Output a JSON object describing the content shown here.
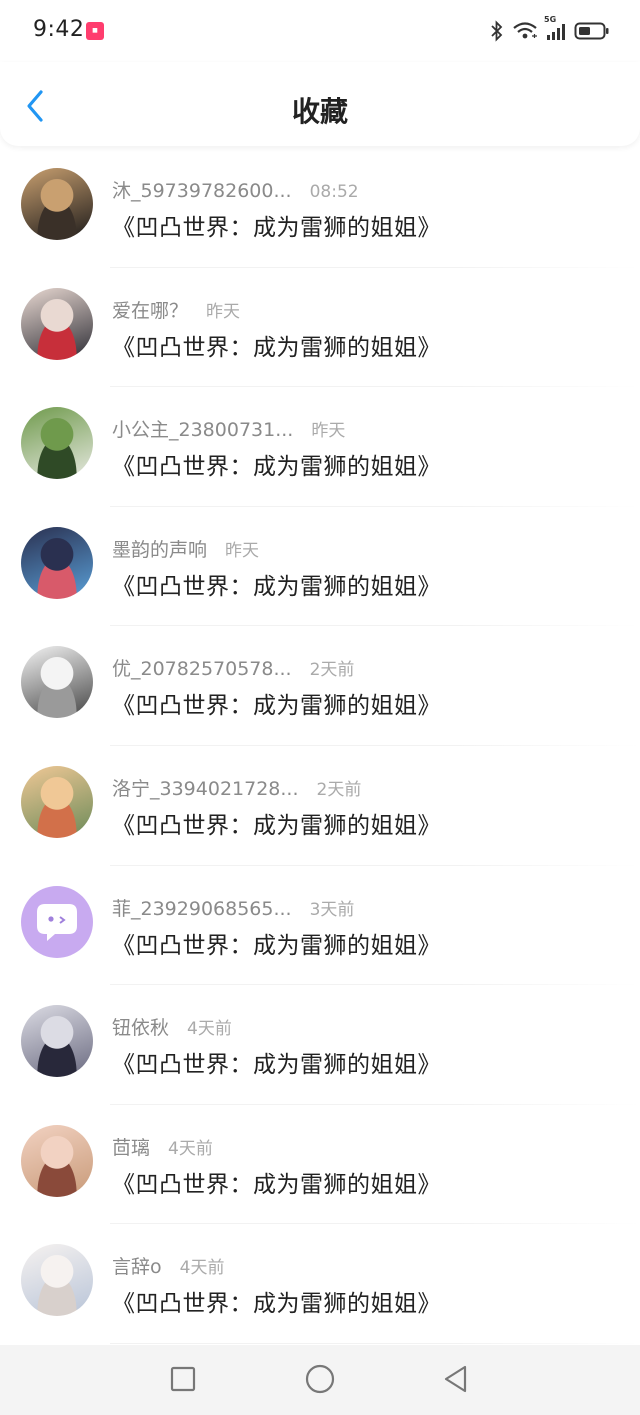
{
  "status_bar": {
    "time": "9:42",
    "app_icon": "app-notification-icon",
    "network_label": "5G",
    "icons": [
      "bluetooth-icon",
      "wifi-icon",
      "signal-icon",
      "battery-icon"
    ]
  },
  "header": {
    "title": "收藏",
    "back_icon": "chevron-left-icon",
    "accent_color": "#2196f3"
  },
  "items": [
    {
      "username": "沐_59739782600...",
      "time": "08:52",
      "title": "《凹凸世界：成为雷狮的姐姐》",
      "avatar_colors": [
        "#c9a070",
        "#3a3028",
        "#1c1a1a"
      ]
    },
    {
      "username": "爱在哪？",
      "time": "昨天",
      "title": "《凹凸世界：成为雷狮的姐姐》",
      "avatar_colors": [
        "#e9d9d2",
        "#c72f3a",
        "#2c2c34"
      ]
    },
    {
      "username": "小公主_23800731...",
      "time": "昨天",
      "title": "《凹凸世界：成为雷狮的姐姐》",
      "avatar_colors": [
        "#6f9a4c",
        "#2f4a26",
        "#e6e8e0"
      ]
    },
    {
      "username": "墨韵的声响",
      "time": "昨天",
      "title": "《凹凸世界：成为雷狮的姐姐》",
      "avatar_colors": [
        "#2a3050",
        "#d85a6a",
        "#5aa0d8"
      ]
    },
    {
      "username": "优_20782570578...",
      "time": "2天前",
      "title": "《凹凸世界：成为雷狮的姐姐》",
      "avatar_colors": [
        "#f4f4f4",
        "#9a9a9a",
        "#444444"
      ]
    },
    {
      "username": "洛宁_3394021728...",
      "time": "2天前",
      "title": "《凹凸世界：成为雷狮的姐姐》",
      "avatar_colors": [
        "#f0c896",
        "#d2704a",
        "#6b8a58"
      ]
    },
    {
      "username": "菲_23929068565...",
      "time": "3天前",
      "title": "《凹凸世界：成为雷狮的姐姐》",
      "avatar_colors": [
        "#c8aaf0",
        "#ffffff",
        "#a080dc"
      ]
    },
    {
      "username": "钮依秋",
      "time": "4天前",
      "title": "《凹凸世界：成为雷狮的姐姐》",
      "avatar_colors": [
        "#dcdce4",
        "#28283a",
        "#6a6a80"
      ]
    },
    {
      "username": "茴璃",
      "time": "4天前",
      "title": "《凹凸世界：成为雷狮的姐姐》",
      "avatar_colors": [
        "#f2d2c2",
        "#8a4a3a",
        "#c89a78"
      ]
    },
    {
      "username": "言辞o",
      "time": "4天前",
      "title": "《凹凸世界：成为雷狮的姐姐》",
      "avatar_colors": [
        "#f6f2f0",
        "#d8d0cc",
        "#b8c4d8"
      ]
    }
  ],
  "nav_bar": {
    "recents_icon": "square-icon",
    "home_icon": "circle-icon",
    "back_icon": "triangle-back-icon"
  }
}
